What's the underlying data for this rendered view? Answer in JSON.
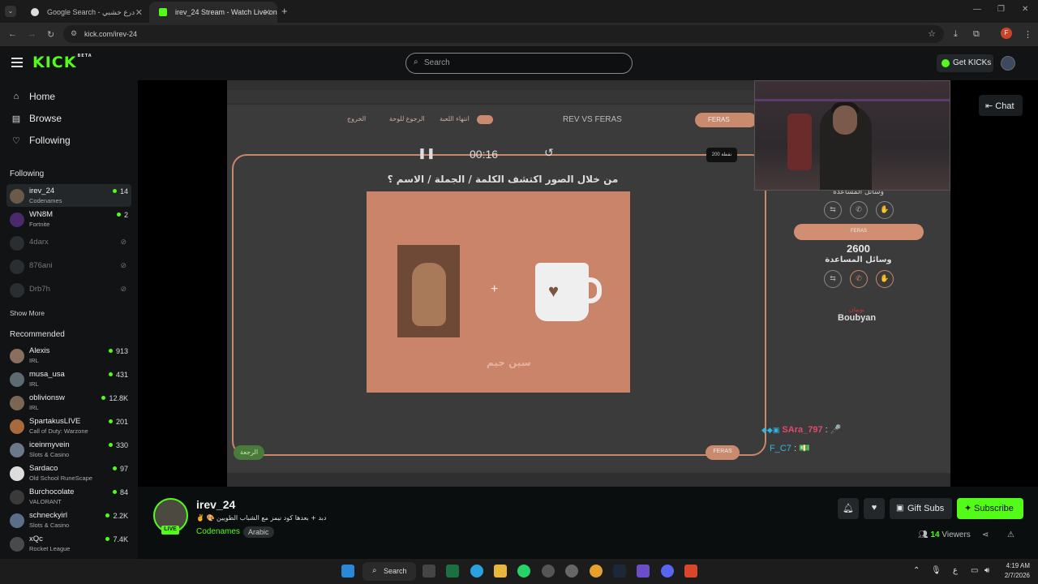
{
  "browser": {
    "tabs": [
      {
        "title": "Google Search - درع خشبي",
        "active": false
      },
      {
        "title": "irev_24 Stream - Watch Live on",
        "active": true
      }
    ],
    "new_tab": "+",
    "url": "kick.com/irev-24",
    "profile_initial": "F"
  },
  "header": {
    "logo": "KICK",
    "logo_badge": "BETA",
    "search_placeholder": "Search",
    "get_kicks_label": "Get KICKs"
  },
  "sidebar": {
    "nav": [
      {
        "label": "Home",
        "icon": "home-icon"
      },
      {
        "label": "Browse",
        "icon": "browse-icon"
      },
      {
        "label": "Following",
        "icon": "heart-icon"
      }
    ],
    "following_title": "Following",
    "following": [
      {
        "name": "irev_24",
        "category": "Codenames",
        "viewers": "14",
        "live": true,
        "color": "#6b5a48"
      },
      {
        "name": "WN8M",
        "category": "Fortnite",
        "viewers": "2",
        "live": true,
        "color": "#4a2a6a"
      },
      {
        "name": "4darx",
        "live": false
      },
      {
        "name": "876ani",
        "live": false
      },
      {
        "name": "Drb7h",
        "live": false
      }
    ],
    "show_more": "Show More",
    "recommended_title": "Recommended",
    "recommended": [
      {
        "name": "Alexis",
        "category": "IRL",
        "viewers": "913",
        "color": "#8a6e5e"
      },
      {
        "name": "musa_usa",
        "category": "IRL",
        "viewers": "431",
        "color": "#5e6a72"
      },
      {
        "name": "oblivionsw",
        "category": "IRL",
        "viewers": "12.8K",
        "color": "#7a6652"
      },
      {
        "name": "SpartakusLIVE",
        "category": "Call of Duty: Warzone",
        "viewers": "201",
        "color": "#a86a3a"
      },
      {
        "name": "iceinmyvein",
        "category": "Slots & Casino",
        "viewers": "330",
        "color": "#6a7a8a"
      },
      {
        "name": "Sardaco",
        "category": "Old School RuneScape",
        "viewers": "97",
        "color": "#dddddd"
      },
      {
        "name": "Burchocolate",
        "category": "VALORANT",
        "viewers": "84",
        "color": "#3a3a3a"
      },
      {
        "name": "schneckyirl",
        "category": "Slots & Casino",
        "viewers": "2.2K",
        "color": "#5a6e8a"
      },
      {
        "name": "xQc",
        "category": "Rocket League",
        "viewers": "7.4K",
        "color": "#4a4a4a"
      }
    ]
  },
  "player": {
    "timer": "00:16",
    "question": "من خلال الصور اكتشف الكلمة / الجملة / الاسم ؟",
    "match_title": "REV VS FERAS",
    "team_name": "FERAS",
    "points_label": "200 نقطة",
    "top_actions": [
      "الخروج",
      "الرجوع للوحة",
      "انتهاء اللعبة"
    ],
    "helpers_label_top": "وسائل المساعدة",
    "score": "2600",
    "helpers_label": "وسائل المساعدة",
    "sponsor_ar": "بوبيان",
    "sponsor_en": "Boubyan",
    "brandmark": "سين جيم",
    "exit_label": "الرجعة",
    "chat_overlay": [
      {
        "user": "SAra_797",
        "color": "#e24a6a",
        "msg": "🎤"
      },
      {
        "user": "F_C7",
        "color": "#2fb6e0",
        "msg": "💵"
      }
    ],
    "chat_button": "Chat"
  },
  "stream": {
    "channel": "irev_24",
    "title": "✌️ 🎨 دبد + بعدها كود نيمز مع الشباب الطويين",
    "category": "Codenames",
    "tag": "Arabic",
    "live_badge": "LIVE",
    "gift_label": "Gift Subs",
    "subscribe_label": "Subscribe",
    "viewers_count": "14",
    "viewers_label": "Viewers"
  },
  "taskbar": {
    "search_label": "Search",
    "time": "4:19 AM",
    "date": "2/7/2026",
    "lang": "ع"
  }
}
